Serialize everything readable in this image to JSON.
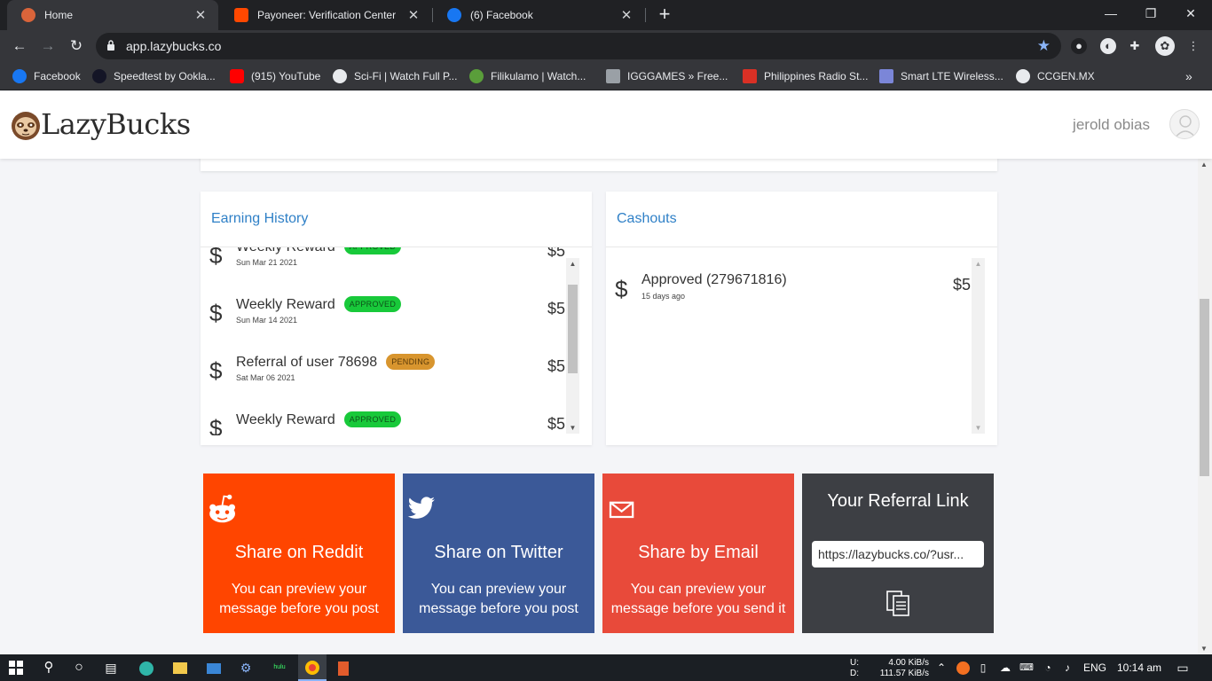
{
  "browser": {
    "tabs": [
      {
        "title": "Home",
        "favicon_color": "#d9643a",
        "active": true
      },
      {
        "title": "Payoneer: Verification Center",
        "favicon_color": "#ff4800",
        "active": false
      },
      {
        "title": "(6) Facebook",
        "favicon_color": "#1877f2",
        "active": false
      }
    ],
    "url": "app.lazybucks.co",
    "bookmarks": [
      {
        "label": "Facebook",
        "icon_color": "#1877f2"
      },
      {
        "label": "Speedtest by Ookla...",
        "icon_color": "#141526"
      },
      {
        "label": "(915) YouTube",
        "icon_color": "#ff0000"
      },
      {
        "label": "Sci-Fi | Watch Full P...",
        "icon_color": "#e8eaed"
      },
      {
        "label": "Filikulamo | Watch...",
        "icon_color": "#5a9e3a"
      },
      {
        "label": "IGGGAMES » Free...",
        "icon_color": "#9aa0a6"
      },
      {
        "label": "Philippines Radio St...",
        "icon_color": "#d93025"
      },
      {
        "label": "Smart LTE Wireless...",
        "icon_color": "#7b86d8"
      },
      {
        "label": "CCGEN.MX",
        "icon_color": "#e8eaed"
      }
    ]
  },
  "app": {
    "brand": "LazyBucks",
    "user_name": "jerold obias"
  },
  "earning_history": {
    "title": "Earning History",
    "rows": [
      {
        "label": "Weekly Reward",
        "date": "Sun Mar 21 2021",
        "status": "APPROVED",
        "amount": "$5"
      },
      {
        "label": "Weekly Reward",
        "date": "Sun Mar 14 2021",
        "status": "APPROVED",
        "amount": "$5"
      },
      {
        "label": "Referral of user 78698",
        "date": "Sat Mar 06 2021",
        "status": "PENDING",
        "amount": "$5"
      },
      {
        "label": "Weekly Reward",
        "date": "",
        "status": "APPROVED",
        "amount": "$5"
      }
    ]
  },
  "cashouts": {
    "title": "Cashouts",
    "rows": [
      {
        "label": "Approved (279671816)",
        "date": "15 days ago",
        "amount": "$5"
      }
    ]
  },
  "share": {
    "reddit": {
      "title": "Share on Reddit",
      "desc": "You can preview your message before you post",
      "color": "#ff4500"
    },
    "twitter": {
      "title": "Share on Twitter",
      "desc": "You can preview your message before you post",
      "color": "#3b5998"
    },
    "email": {
      "title": "Share by Email",
      "desc": "You can preview your message before you send it",
      "color": "#e84a3a"
    },
    "referral": {
      "title": "Your Referral Link",
      "link": "https://lazybucks.co/?usr...",
      "color": "#3d3f44"
    }
  },
  "taskbar": {
    "upload_label": "U:",
    "download_label": "D:",
    "upload_speed": "4.00 KiB/s",
    "download_speed": "111.57 KiB/s",
    "language": "ENG",
    "time": "10:14 am"
  }
}
